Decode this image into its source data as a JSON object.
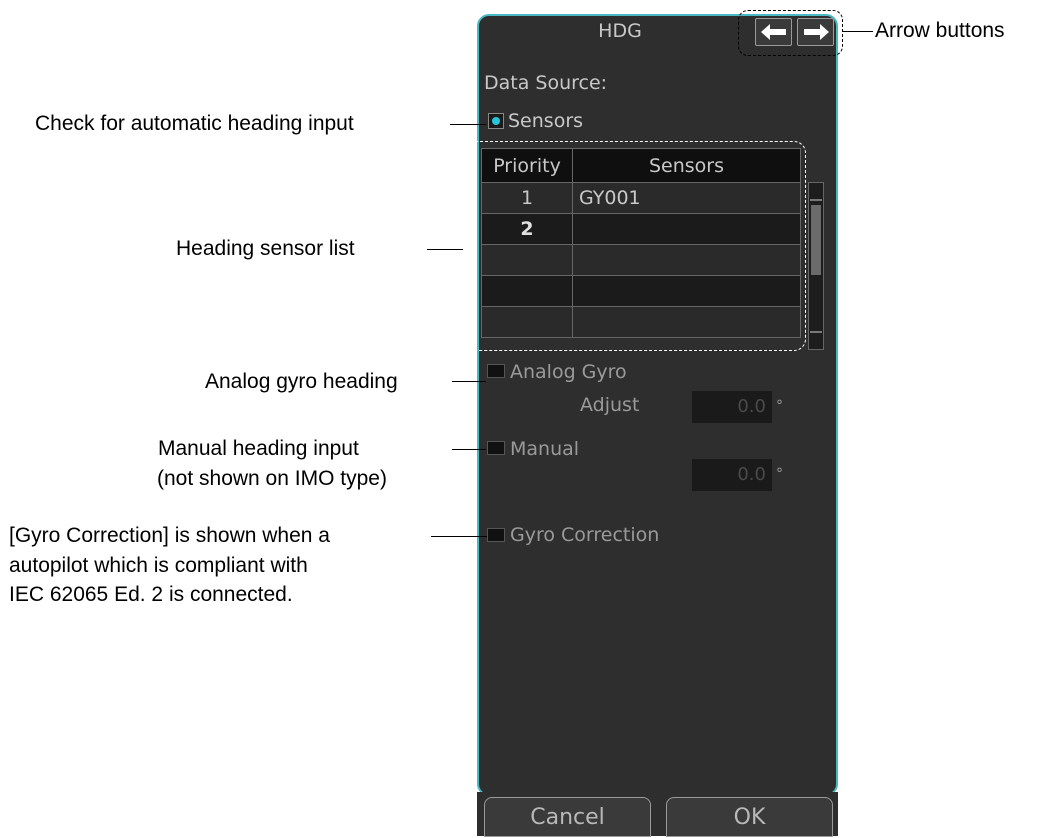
{
  "panel": {
    "title": "HDG",
    "data_source_label": "Data Source:",
    "sensors_radio_label": "Sensors",
    "table": {
      "headers": [
        "Priority",
        "Sensors"
      ],
      "rows": [
        {
          "priority": "1",
          "sensor": "GY001"
        },
        {
          "priority": "2",
          "sensor": ""
        },
        {
          "priority": "",
          "sensor": ""
        },
        {
          "priority": "",
          "sensor": ""
        },
        {
          "priority": "",
          "sensor": ""
        }
      ]
    },
    "analog_gyro_label": "Analog Gyro",
    "adjust_label": "Adjust",
    "adjust_value": "0.0",
    "manual_label": "Manual",
    "manual_value": "0.0",
    "degree_symbol": "°",
    "gyro_correction_label": "Gyro Correction",
    "cancel_label": "Cancel",
    "ok_label": "OK"
  },
  "annotations": {
    "arrow_buttons": "Arrow buttons",
    "check_auto": "Check for automatic heading input",
    "sensor_list": "Heading sensor list",
    "analog_gyro": "Analog gyro heading",
    "manual_line1": "Manual heading input",
    "manual_line2": "(not shown on IMO type)",
    "gyro_line1": "[Gyro Correction] is shown when a",
    "gyro_line2": "autopilot which is compliant with",
    "gyro_line3": "IEC 62065 Ed. 2 is connected."
  },
  "colors": {
    "panel_bg": "#2e2e2e",
    "panel_border": "#4ab8c4",
    "radio_selected": "#29c5d6"
  },
  "icons": [
    "left-arrow-icon",
    "right-arrow-icon"
  ]
}
